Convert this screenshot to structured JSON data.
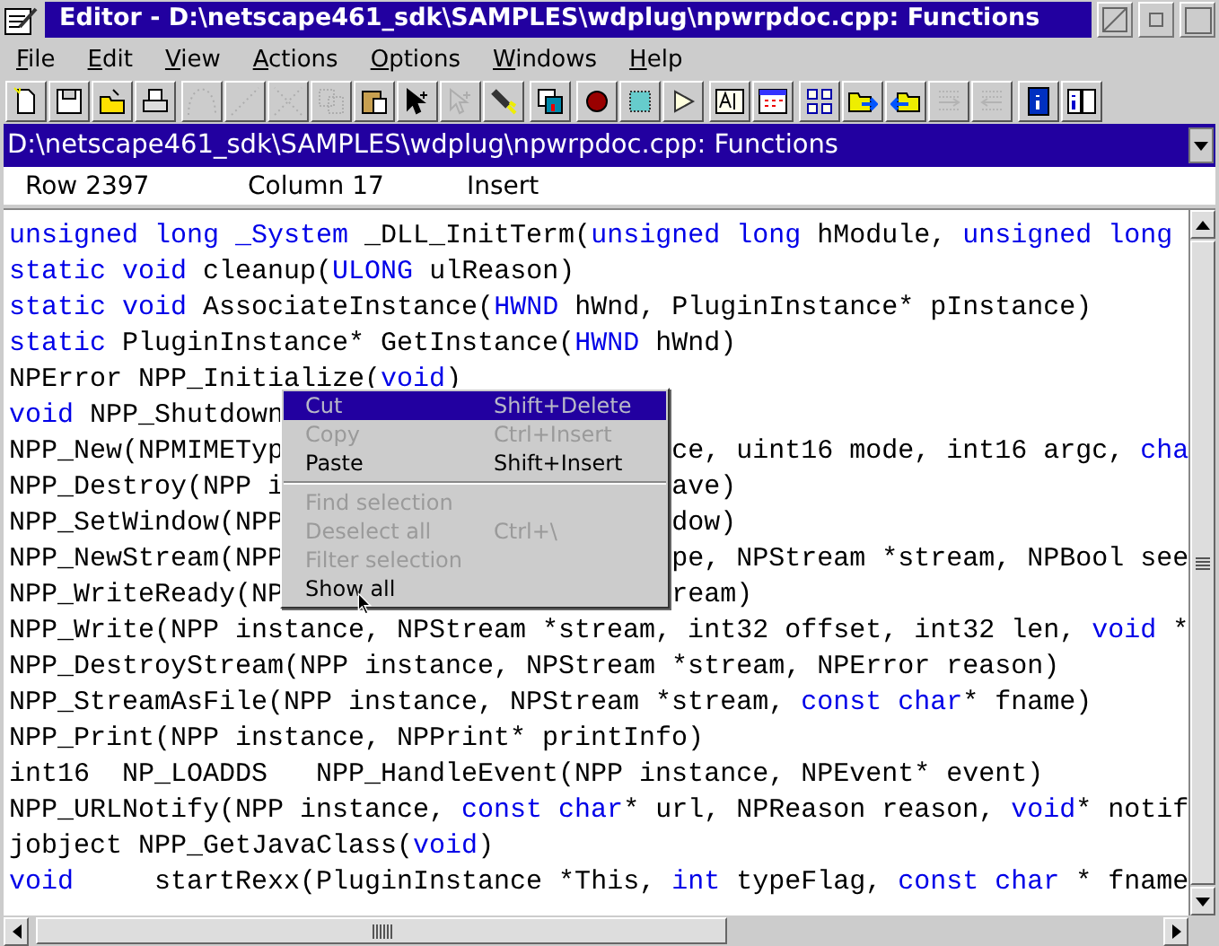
{
  "window": {
    "title": "Editor - D:\\netscape461_sdk\\SAMPLES\\wdplug\\npwrpdoc.cpp: Functions"
  },
  "menubar": [
    "File",
    "Edit",
    "View",
    "Actions",
    "Options",
    "Windows",
    "Help"
  ],
  "toolbar": [
    {
      "kind": "new",
      "disabled": false
    },
    {
      "kind": "save",
      "disabled": false
    },
    {
      "kind": "open",
      "disabled": false
    },
    {
      "kind": "print",
      "disabled": false
    },
    {
      "kind": "undo",
      "disabled": true
    },
    {
      "kind": "redo",
      "disabled": true
    },
    {
      "kind": "cut",
      "disabled": true
    },
    {
      "kind": "copy",
      "disabled": true
    },
    {
      "kind": "paste",
      "disabled": false
    },
    {
      "kind": "pointer",
      "disabled": false
    },
    {
      "kind": "pointer",
      "disabled": true
    },
    {
      "kind": "flashlight",
      "disabled": false
    },
    {
      "kind": "windows",
      "disabled": false
    },
    {
      "kind": "record",
      "disabled": false
    },
    {
      "kind": "stop",
      "disabled": false
    },
    {
      "kind": "play",
      "disabled": false
    },
    {
      "kind": "textbox",
      "disabled": false
    },
    {
      "kind": "calendar",
      "disabled": false
    },
    {
      "kind": "grid",
      "disabled": false
    },
    {
      "kind": "folder-out",
      "disabled": false
    },
    {
      "kind": "folder-in",
      "disabled": false
    },
    {
      "kind": "list-out",
      "disabled": true
    },
    {
      "kind": "list-in",
      "disabled": true
    },
    {
      "kind": "info",
      "disabled": false
    },
    {
      "kind": "info-book",
      "disabled": false
    }
  ],
  "path": "D:\\netscape461_sdk\\SAMPLES\\wdplug\\npwrpdoc.cpp: Functions",
  "status": [
    "Row 2397",
    "Column 17",
    "Insert"
  ],
  "code_lines": [
    {
      "segments": [
        {
          "kind": "keyword",
          "text": "unsigned long _System"
        },
        {
          "kind": "plain",
          "text": " _DLL_InitTerm("
        },
        {
          "kind": "keyword",
          "text": "unsigned long"
        },
        {
          "kind": "plain",
          "text": " hModule, "
        },
        {
          "kind": "keyword",
          "text": "unsigned long"
        }
      ]
    },
    {
      "segments": [
        {
          "kind": "keyword",
          "text": "static void"
        },
        {
          "kind": "plain",
          "text": " cleanup("
        },
        {
          "kind": "keyword",
          "text": "ULONG"
        },
        {
          "kind": "plain",
          "text": " ulReason)"
        }
      ]
    },
    {
      "segments": [
        {
          "kind": "keyword",
          "text": "static void"
        },
        {
          "kind": "plain",
          "text": " AssociateInstance("
        },
        {
          "kind": "keyword",
          "text": "HWND"
        },
        {
          "kind": "plain",
          "text": " hWnd, PluginInstance* pInstance)"
        }
      ]
    },
    {
      "segments": [
        {
          "kind": "keyword",
          "text": "static"
        },
        {
          "kind": "plain",
          "text": " PluginInstance* GetInstance("
        },
        {
          "kind": "keyword",
          "text": "HWND"
        },
        {
          "kind": "plain",
          "text": " hWnd)"
        }
      ]
    },
    {
      "segments": [
        {
          "kind": "plain",
          "text": "NPError NPP_Initialize("
        },
        {
          "kind": "keyword",
          "text": "void"
        },
        {
          "kind": "plain",
          "text": ")"
        }
      ]
    },
    {
      "segments": [
        {
          "kind": "keyword",
          "text": "void"
        },
        {
          "kind": "plain",
          "text": " NPP_Shutdown"
        }
      ]
    },
    {
      "segments": [
        {
          "kind": "plain",
          "text": "NPP_New(NPMIMETyp"
        }
      ],
      "segments_right": [
        {
          "kind": "plain",
          "text": "ce, uint16 mode, int16 argc, "
        },
        {
          "kind": "keyword",
          "text": "cha"
        }
      ]
    },
    {
      "segments": [
        {
          "kind": "plain",
          "text": "NPP_Destroy(NPP i"
        }
      ],
      "segments_right": [
        {
          "kind": "plain",
          "text": "ave)"
        }
      ]
    },
    {
      "segments": [
        {
          "kind": "plain",
          "text": "NPP_SetWindow(NPP"
        }
      ],
      "segments_right": [
        {
          "kind": "plain",
          "text": "dow)"
        }
      ]
    },
    {
      "segments": [
        {
          "kind": "plain",
          "text": "NPP_NewStream(NPP"
        }
      ],
      "segments_right": [
        {
          "kind": "plain",
          "text": "pe, NPStream *stream, NPBool see"
        }
      ]
    },
    {
      "segments": [
        {
          "kind": "plain",
          "text": "NPP_WriteReady(NP"
        }
      ],
      "segments_right": [
        {
          "kind": "plain",
          "text": "ream)"
        }
      ]
    },
    {
      "segments": [
        {
          "kind": "plain",
          "text": "NPP_Write(NPP instance, NPStream *stream, int32 offset, int32 len, "
        },
        {
          "kind": "keyword",
          "text": "void"
        },
        {
          "kind": "plain",
          "text": " *"
        }
      ]
    },
    {
      "segments": [
        {
          "kind": "plain",
          "text": "NPP_DestroyStream(NPP instance, NPStream *stream, NPError reason)"
        }
      ]
    },
    {
      "segments": [
        {
          "kind": "plain",
          "text": "NPP_StreamAsFile(NPP instance, NPStream *stream, "
        },
        {
          "kind": "keyword",
          "text": "const char"
        },
        {
          "kind": "plain",
          "text": "* fname)"
        }
      ]
    },
    {
      "segments": [
        {
          "kind": "plain",
          "text": "NPP_Print(NPP instance, NPPrint* printInfo)"
        }
      ]
    },
    {
      "segments": [
        {
          "kind": "plain",
          "text": "int16  NP_LOADDS   NPP_HandleEvent(NPP instance, NPEvent* event)"
        }
      ]
    },
    {
      "segments": [
        {
          "kind": "plain",
          "text": "NPP_URLNotify(NPP instance, "
        },
        {
          "kind": "keyword",
          "text": "const char"
        },
        {
          "kind": "plain",
          "text": "* url, NPReason reason, "
        },
        {
          "kind": "keyword",
          "text": "void"
        },
        {
          "kind": "plain",
          "text": "* notif"
        }
      ]
    },
    {
      "segments": [
        {
          "kind": "plain",
          "text": "jobject NPP_GetJavaClass("
        },
        {
          "kind": "keyword",
          "text": "void"
        },
        {
          "kind": "plain",
          "text": ")"
        }
      ]
    },
    {
      "segments": [
        {
          "kind": "keyword",
          "text": "void"
        },
        {
          "kind": "plain",
          "text": "     startRexx(PluginInstance *This, "
        },
        {
          "kind": "keyword",
          "text": "int"
        },
        {
          "kind": "plain",
          "text": " typeFlag, "
        },
        {
          "kind": "keyword",
          "text": "const char"
        },
        {
          "kind": "plain",
          "text": " * fname"
        }
      ]
    }
  ],
  "context_menu": [
    {
      "kind": "item",
      "label": "Cut",
      "shortcut": "Shift+Delete",
      "disabled": true,
      "selected": true
    },
    {
      "kind": "item",
      "label": "Copy",
      "shortcut": "Ctrl+Insert",
      "disabled": true,
      "selected": false
    },
    {
      "kind": "item",
      "label": "Paste",
      "shortcut": "Shift+Insert",
      "disabled": false,
      "selected": false
    },
    {
      "kind": "separator"
    },
    {
      "kind": "item",
      "label": "Find selection",
      "disabled": true,
      "selected": false
    },
    {
      "kind": "item",
      "label": "Deselect all",
      "shortcut": "Ctrl+\\",
      "disabled": true,
      "selected": false
    },
    {
      "kind": "item",
      "label": "Filter selection",
      "disabled": true,
      "selected": false
    },
    {
      "kind": "item",
      "label": "Show all",
      "disabled": false,
      "selected": false
    }
  ]
}
